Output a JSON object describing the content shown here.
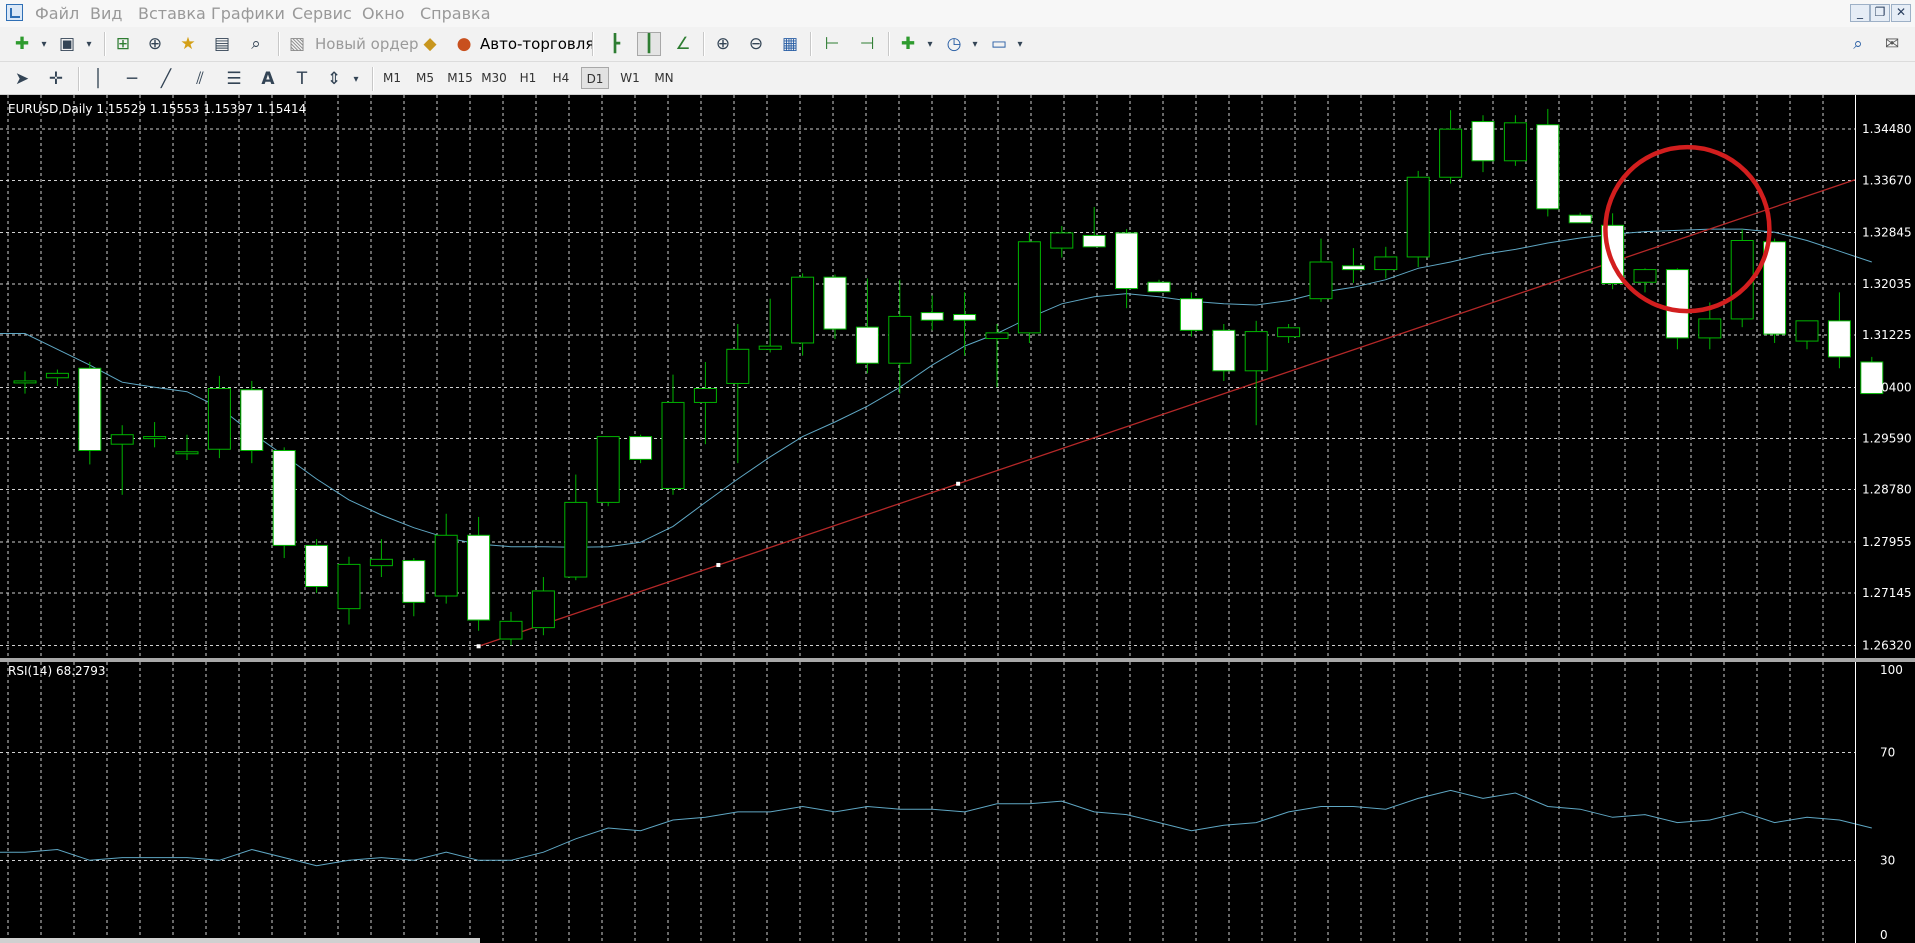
{
  "menu": {
    "items": [
      "Файл",
      "Вид",
      "Вставка",
      "Графики",
      "Сервис",
      "Окно",
      "Справка"
    ]
  },
  "window_buttons": [
    "minimize",
    "restore",
    "close"
  ],
  "toolbar": {
    "new_order_label": "Новый ордер",
    "autotrading_label": "Авто-торговля",
    "icons": [
      "new-chart-icon",
      "profiles-icon",
      "market-watch-icon",
      "navigator-icon",
      "favorites-icon",
      "terminal-icon",
      "strategy-tester-icon",
      "new-order-icon",
      "autotrading-icon",
      "bar-chart-icon",
      "candlesticks-icon",
      "line-chart-icon",
      "zoom-in-icon",
      "zoom-out-icon",
      "tile-windows-icon",
      "chart-shift-icon",
      "autoscroll-icon",
      "indicators-icon",
      "periods-icon",
      "templates-icon",
      "search-icon",
      "chat-icon"
    ]
  },
  "timeframes": {
    "items": [
      "M1",
      "M5",
      "M15",
      "M30",
      "H1",
      "H4",
      "D1",
      "W1",
      "MN"
    ],
    "active": "D1"
  },
  "chart": {
    "symbol_header": "EURUSD,Daily  1.15529 1.15553 1.15397 1.15414",
    "price_labels": [
      "1.34480",
      "1.33670",
      "1.32845",
      "1.32035",
      "1.31225",
      "1.30400",
      "1.29590",
      "1.28780",
      "1.27955",
      "1.27145",
      "1.26320"
    ],
    "rsi_header": "RSI(14) 68.2793",
    "rsi_labels": [
      "100",
      "70",
      "30",
      "0"
    ],
    "colors": {
      "background": "#000000",
      "grid": "#d0d0d0",
      "bull_candle": "#000000",
      "bear_candle": "#ffffff",
      "candle_outline": "#00b400",
      "moving_average": "#5fa7c4",
      "trendline": "#b42828",
      "annotation_circle": "#d21e1e",
      "rsi_line": "#5fa7c4"
    }
  },
  "chart_data": {
    "type": "candlestick",
    "title": "EURUSD,Daily",
    "ohlc_header": [
      1.15529,
      1.15553,
      1.15397,
      1.15414
    ],
    "ylim": [
      1.2612,
      1.3502
    ],
    "candles": [
      {
        "o": 1.305,
        "h": 1.3065,
        "l": 1.303,
        "c": 1.305
      },
      {
        "o": 1.3055,
        "h": 1.3068,
        "l": 1.3042,
        "c": 1.3062
      },
      {
        "o": 1.307,
        "h": 1.308,
        "l": 1.2918,
        "c": 1.294
      },
      {
        "o": 1.295,
        "h": 1.298,
        "l": 1.287,
        "c": 1.2965
      },
      {
        "o": 1.296,
        "h": 1.2985,
        "l": 1.2945,
        "c": 1.2962
      },
      {
        "o": 1.2935,
        "h": 1.2965,
        "l": 1.2925,
        "c": 1.2938
      },
      {
        "o": 1.2942,
        "h": 1.3058,
        "l": 1.2928,
        "c": 1.3038
      },
      {
        "o": 1.3036,
        "h": 1.305,
        "l": 1.292,
        "c": 1.294
      },
      {
        "o": 1.294,
        "h": 1.2945,
        "l": 1.277,
        "c": 1.279
      },
      {
        "o": 1.279,
        "h": 1.28,
        "l": 1.2715,
        "c": 1.2725
      },
      {
        "o": 1.269,
        "h": 1.2772,
        "l": 1.2665,
        "c": 1.276
      },
      {
        "o": 1.2758,
        "h": 1.28,
        "l": 1.274,
        "c": 1.2768
      },
      {
        "o": 1.2766,
        "h": 1.277,
        "l": 1.2678,
        "c": 1.27
      },
      {
        "o": 1.271,
        "h": 1.284,
        "l": 1.2698,
        "c": 1.2806
      },
      {
        "o": 1.2806,
        "h": 1.2835,
        "l": 1.2655,
        "c": 1.2672
      },
      {
        "o": 1.2642,
        "h": 1.2685,
        "l": 1.2632,
        "c": 1.267
      },
      {
        "o": 1.266,
        "h": 1.274,
        "l": 1.2648,
        "c": 1.2718
      },
      {
        "o": 1.274,
        "h": 1.2902,
        "l": 1.2735,
        "c": 1.2858
      },
      {
        "o": 1.2858,
        "h": 1.2952,
        "l": 1.2852,
        "c": 1.2962
      },
      {
        "o": 1.2962,
        "h": 1.2965,
        "l": 1.292,
        "c": 1.2926
      },
      {
        "o": 1.288,
        "h": 1.306,
        "l": 1.287,
        "c": 1.3016
      },
      {
        "o": 1.3016,
        "h": 1.308,
        "l": 1.295,
        "c": 1.3038
      },
      {
        "o": 1.3046,
        "h": 1.314,
        "l": 1.292,
        "c": 1.31
      },
      {
        "o": 1.31,
        "h": 1.318,
        "l": 1.3095,
        "c": 1.3105
      },
      {
        "o": 1.311,
        "h": 1.322,
        "l": 1.309,
        "c": 1.3214
      },
      {
        "o": 1.3214,
        "h": 1.3218,
        "l": 1.3116,
        "c": 1.3132
      },
      {
        "o": 1.3135,
        "h": 1.3212,
        "l": 1.3062,
        "c": 1.3078
      },
      {
        "o": 1.3078,
        "h": 1.321,
        "l": 1.303,
        "c": 1.3152
      },
      {
        "o": 1.3158,
        "h": 1.3185,
        "l": 1.313,
        "c": 1.3146
      },
      {
        "o": 1.3155,
        "h": 1.319,
        "l": 1.309,
        "c": 1.3146
      },
      {
        "o": 1.3117,
        "h": 1.314,
        "l": 1.304,
        "c": 1.3126
      },
      {
        "o": 1.3126,
        "h": 1.3285,
        "l": 1.311,
        "c": 1.327
      },
      {
        "o": 1.326,
        "h": 1.3295,
        "l": 1.3245,
        "c": 1.3284
      },
      {
        "o": 1.328,
        "h": 1.3325,
        "l": 1.327,
        "c": 1.3262
      },
      {
        "o": 1.3284,
        "h": 1.329,
        "l": 1.3165,
        "c": 1.3196
      },
      {
        "o": 1.3206,
        "h": 1.321,
        "l": 1.319,
        "c": 1.3191
      },
      {
        "o": 1.318,
        "h": 1.319,
        "l": 1.312,
        "c": 1.313
      },
      {
        "o": 1.313,
        "h": 1.314,
        "l": 1.305,
        "c": 1.3066
      },
      {
        "o": 1.3066,
        "h": 1.3145,
        "l": 1.298,
        "c": 1.3128
      },
      {
        "o": 1.312,
        "h": 1.314,
        "l": 1.311,
        "c": 1.3134
      },
      {
        "o": 1.318,
        "h": 1.3275,
        "l": 1.3175,
        "c": 1.3238
      },
      {
        "o": 1.3232,
        "h": 1.326,
        "l": 1.3205,
        "c": 1.3226
      },
      {
        "o": 1.3226,
        "h": 1.3262,
        "l": 1.3212,
        "c": 1.3246
      },
      {
        "o": 1.3246,
        "h": 1.3382,
        "l": 1.323,
        "c": 1.3372
      },
      {
        "o": 1.3372,
        "h": 1.3478,
        "l": 1.3362,
        "c": 1.3448
      },
      {
        "o": 1.346,
        "h": 1.347,
        "l": 1.338,
        "c": 1.3398
      },
      {
        "o": 1.3398,
        "h": 1.347,
        "l": 1.339,
        "c": 1.3458
      },
      {
        "o": 1.3455,
        "h": 1.348,
        "l": 1.331,
        "c": 1.3322
      },
      {
        "o": 1.3312,
        "h": 1.3316,
        "l": 1.3305,
        "c": 1.33
      },
      {
        "o": 1.3296,
        "h": 1.3315,
        "l": 1.3195,
        "c": 1.3204
      },
      {
        "o": 1.3206,
        "h": 1.3228,
        "l": 1.319,
        "c": 1.3226
      },
      {
        "o": 1.3226,
        "h": 1.3228,
        "l": 1.31,
        "c": 1.3118
      },
      {
        "o": 1.3118,
        "h": 1.3174,
        "l": 1.31,
        "c": 1.3148
      },
      {
        "o": 1.3148,
        "h": 1.329,
        "l": 1.3135,
        "c": 1.3272
      },
      {
        "o": 1.327,
        "h": 1.3275,
        "l": 1.311,
        "c": 1.3124
      },
      {
        "o": 1.3113,
        "h": 1.3145,
        "l": 1.31,
        "c": 1.3145
      },
      {
        "o": 1.3145,
        "h": 1.319,
        "l": 1.307,
        "c": 1.3088
      },
      {
        "o": 1.308,
        "h": 1.3088,
        "l": 1.303,
        "c": 1.303
      }
    ],
    "moving_average": [
      1.3125,
      1.31,
      1.3075,
      1.3048,
      1.304,
      1.3033,
      1.3008,
      1.2968,
      1.2932,
      1.2895,
      1.2862,
      1.2838,
      1.2818,
      1.2802,
      1.2792,
      1.2788,
      1.2788,
      1.2787,
      1.2788,
      1.2795,
      1.282,
      1.2858,
      1.2895,
      1.293,
      1.2962,
      1.2985,
      1.301,
      1.304,
      1.3075,
      1.3105,
      1.3125,
      1.315,
      1.3172,
      1.3183,
      1.3188,
      1.3183,
      1.3176,
      1.3172,
      1.317,
      1.3177,
      1.319,
      1.3198,
      1.321,
      1.3228,
      1.3238,
      1.325,
      1.3258,
      1.3268,
      1.3276,
      1.3282,
      1.3286,
      1.3288,
      1.329,
      1.329,
      1.3285,
      1.3272,
      1.3255,
      1.3238
    ],
    "rsi": {
      "name": "RSI(14)",
      "current": 68.2793,
      "ylim": [
        0,
        100
      ],
      "levels": [
        70,
        30
      ],
      "values": [
        33,
        34,
        30,
        31,
        31,
        31,
        30,
        34,
        31,
        28,
        30,
        31,
        30,
        33,
        30,
        30,
        33,
        38,
        42,
        41,
        45,
        46,
        48,
        48,
        50,
        48,
        50,
        49,
        49,
        48,
        51,
        51,
        52,
        48,
        47,
        44,
        41,
        43,
        44,
        48,
        50,
        50,
        49,
        53,
        56,
        53,
        55,
        50,
        49,
        46,
        47,
        44,
        45,
        48,
        44,
        46,
        45,
        42
      ]
    },
    "trendline": {
      "start": {
        "index": 14,
        "price": 1.26305
      },
      "end": {
        "index": null,
        "price": 1.3368
      },
      "markers": [
        14.0,
        21.4,
        28.8
      ]
    },
    "annotation": {
      "shape": "circle",
      "color": "#d21e1e",
      "center_index": 51,
      "center_price": 1.329
    }
  }
}
